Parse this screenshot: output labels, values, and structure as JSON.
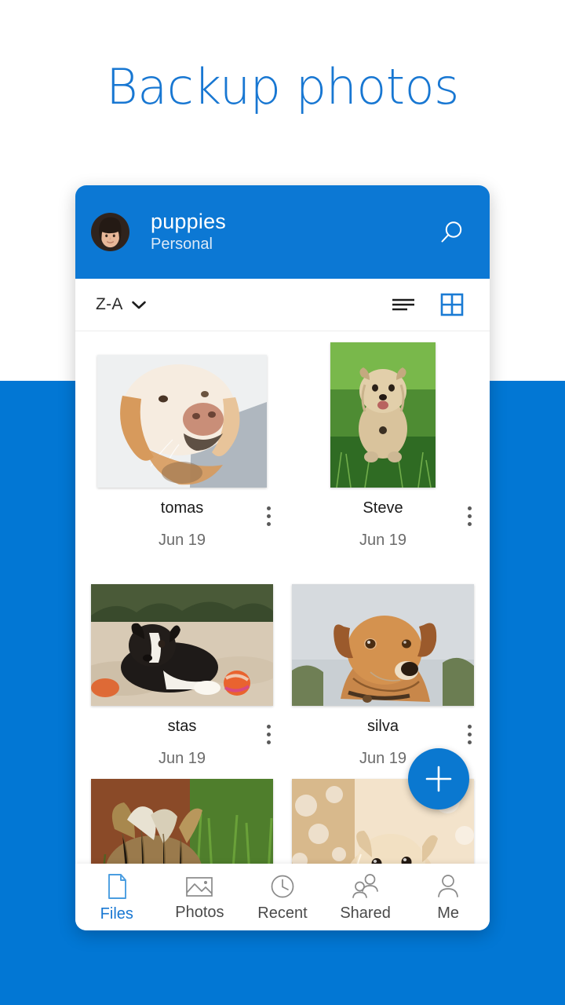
{
  "page": {
    "headline": "Backup photos",
    "headline_color": "#1877d2",
    "band_color": "#0277d4",
    "accent_color": "#0c78d4"
  },
  "app_header": {
    "title": "puppies",
    "subtitle": "Personal",
    "avatar_icon": "user-avatar-photo",
    "search_icon": "search-icon"
  },
  "toolbar": {
    "sort_label": "Z-A",
    "sort_chevron_icon": "chevron-down-icon",
    "list_view_icon": "list-view-icon",
    "grid_view_icon": "grid-view-icon",
    "active_view": "grid"
  },
  "files": [
    {
      "name": "tomas",
      "date": "Jun 19",
      "orientation": "landscape",
      "photo": "golden-retriever-closeup",
      "menu_icon": "more-vertical-icon"
    },
    {
      "name": "Steve",
      "date": "Jun 19",
      "orientation": "portrait",
      "photo": "terrier-on-grass",
      "menu_icon": "more-vertical-icon"
    },
    {
      "name": "stas",
      "date": "Jun 19",
      "orientation": "landscape",
      "photo": "black-white-puppy-on-sand-with-ball",
      "menu_icon": "more-vertical-icon"
    },
    {
      "name": "silva",
      "date": "Jun 19",
      "orientation": "landscape",
      "photo": "tan-dog-portrait",
      "menu_icon": "more-vertical-icon"
    }
  ],
  "partial_row": [
    {
      "photo": "yorkshire-terrier-in-grass"
    },
    {
      "photo": "cream-puppy-bokeh"
    }
  ],
  "fab": {
    "icon": "plus-icon",
    "color": "#0a78d0"
  },
  "bottom_nav": {
    "active_index": 0,
    "items": [
      {
        "label": "Files",
        "icon": "document-icon"
      },
      {
        "label": "Photos",
        "icon": "image-icon"
      },
      {
        "label": "Recent",
        "icon": "clock-icon"
      },
      {
        "label": "Shared",
        "icon": "people-icon"
      },
      {
        "label": "Me",
        "icon": "person-icon"
      }
    ]
  }
}
